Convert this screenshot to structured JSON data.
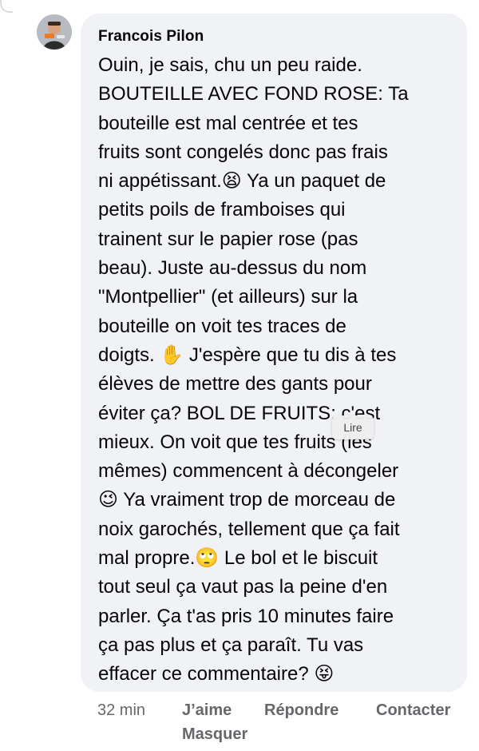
{
  "comment": {
    "author": "Francois Pilon",
    "text": "Ouin, je sais, chu un peu raide.\nBOUTEILLE AVEC FOND ROSE: Ta\nbouteille est mal centrée et tes\nfruits sont congelés donc pas frais\nni appétissant.😫 Ya un paquet de\npetits poils de framboises qui\ntrainent sur le papier rose (pas\nbeau). Juste au-dessus du nom\n\"Montpellier\" (et ailleurs) sur la\nbouteille on voit tes traces de\ndoigts. ✋ J'espère que tu dis à tes\nélèves de mettre des gants pour\néviter ça? BOL DE FRUITS: c'est\nmieux. On voit que tes fruits (les\nmêmes) commencent à décongeler\n😉 Ya vraiment trop de morceau de\nnoix garochés, tellement que ça fait\nmal propre.🙄 Le bol et le biscuit\ntout seul ça vaut pas la peine d'en\nparler. Ça t'as pris 10 minutes faire\nça pas plus et ça paraît. Tu vas\neffacer ce commentaire? 😝",
    "tooltip": "Lire"
  },
  "actions": {
    "time": "32 min",
    "like": "J’aime",
    "reply": "Répondre",
    "contact": "Contacter",
    "hide": "Masquer"
  },
  "colors": {
    "bubble_bg": "#f0f2f5",
    "text": "#050505",
    "meta": "#65676b"
  }
}
